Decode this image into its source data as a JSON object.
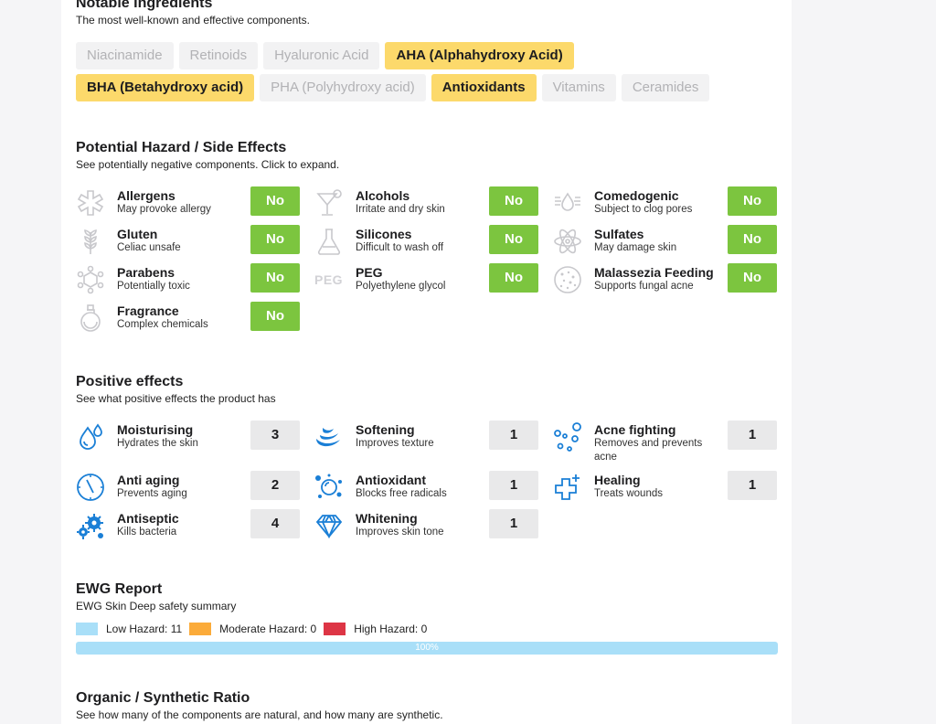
{
  "ingredients": {
    "title": "Notable Ingredients",
    "subtitle": "The most well-known and effective components.",
    "chips": [
      {
        "label": "Niacinamide",
        "active": false
      },
      {
        "label": "Retinoids",
        "active": false
      },
      {
        "label": "Hyaluronic Acid",
        "active": false
      },
      {
        "label": "AHA (Alphahydroxy Acid)",
        "active": true
      },
      {
        "label": "BHA (Betahydroxy acid)",
        "active": true
      },
      {
        "label": "PHA (Polyhydroxy acid)",
        "active": false
      },
      {
        "label": "Antioxidants",
        "active": true
      },
      {
        "label": "Vitamins",
        "active": false
      },
      {
        "label": "Ceramides",
        "active": false
      }
    ]
  },
  "hazards": {
    "title": "Potential Hazard / Side Effects",
    "subtitle": "See potentially negative components. Click to expand.",
    "items": [
      {
        "name": "Allergens",
        "desc": "May provoke allergy",
        "value": "No",
        "icon": "allergen-icon"
      },
      {
        "name": "Alcohols",
        "desc": "Irritate and dry skin",
        "value": "No",
        "icon": "cocktail-icon"
      },
      {
        "name": "Comedogenic",
        "desc": "Subject to clog pores",
        "value": "No",
        "icon": "pore-drop-icon"
      },
      {
        "name": "Gluten",
        "desc": "Celiac unsafe",
        "value": "No",
        "icon": "wheat-icon"
      },
      {
        "name": "Silicones",
        "desc": "Difficult to wash off",
        "value": "No",
        "icon": "flask-icon"
      },
      {
        "name": "Sulfates",
        "desc": "May damage skin",
        "value": "No",
        "icon": "atom-icon"
      },
      {
        "name": "Parabens",
        "desc": "Potentially toxic",
        "value": "No",
        "icon": "molecule-icon"
      },
      {
        "name": "PEG",
        "desc": "Polyethylene glycol",
        "value": "No",
        "icon": "peg-icon",
        "icon_text": "PEG"
      },
      {
        "name": "Malassezia Feeding",
        "desc": "Supports fungal acne",
        "value": "No",
        "icon": "fungus-icon"
      },
      {
        "name": "Fragrance",
        "desc": "Complex chemicals",
        "value": "No",
        "icon": "perfume-icon"
      }
    ]
  },
  "positive": {
    "title": "Positive effects",
    "subtitle": "See what positive effects the product has",
    "items": [
      {
        "name": "Moisturising",
        "desc": "Hydrates the skin",
        "value": "3",
        "icon": "water-drops-icon"
      },
      {
        "name": "Softening",
        "desc": "Improves texture",
        "value": "1",
        "icon": "feather-icon"
      },
      {
        "name": "Acne fighting",
        "desc": "Removes and prevents acne",
        "value": "1",
        "icon": "bubbles-icon"
      },
      {
        "name": "Anti aging",
        "desc": "Prevents aging",
        "value": "2",
        "icon": "clock-icon"
      },
      {
        "name": "Antioxidant",
        "desc": "Blocks free radicals",
        "value": "1",
        "icon": "radical-icon"
      },
      {
        "name": "Healing",
        "desc": "Treats wounds",
        "value": "1",
        "icon": "medical-cross-icon"
      },
      {
        "name": "Antiseptic",
        "desc": "Kills bacteria",
        "value": "4",
        "icon": "bacteria-icon"
      },
      {
        "name": "Whitening",
        "desc": "Improves skin tone",
        "value": "1",
        "icon": "diamond-icon"
      }
    ]
  },
  "ewg": {
    "title": "EWG Report",
    "subtitle": "EWG Skin Deep safety summary",
    "legend": [
      {
        "label": "Low Hazard: 11",
        "color": "#a9dff8"
      },
      {
        "label": "Moderate Hazard: 0",
        "color": "#fbab3a"
      },
      {
        "label": "High Hazard: 0",
        "color": "#dd3545"
      }
    ],
    "bar_label": "100%",
    "low_fraction": 1.0
  },
  "ratio": {
    "title": "Organic / Synthetic Ratio",
    "subtitle": "See how many of the components are natural, and how many are synthetic."
  }
}
